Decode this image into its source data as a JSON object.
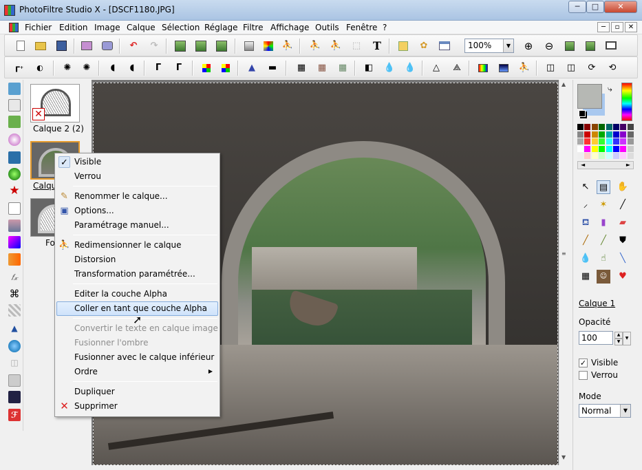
{
  "window": {
    "title": "PhotoFiltre Studio X - [DSCF1180.JPG]",
    "controls": [
      "─",
      "□",
      "✕"
    ]
  },
  "menu": {
    "items": [
      "Fichier",
      "Edition",
      "Image",
      "Calque",
      "Sélection",
      "Réglage",
      "Filtre",
      "Affichage",
      "Outils",
      "Fenêtre",
      "?"
    ],
    "mdi_controls": [
      "─",
      "▫",
      "✕"
    ]
  },
  "toolbar": {
    "zoom_value": "100%",
    "text_tool_glyph": "T"
  },
  "layers": {
    "items": [
      {
        "label": "Calque 2 (2)"
      },
      {
        "label": "Calque 1"
      },
      {
        "label": "Fond"
      }
    ]
  },
  "context_menu": {
    "items": [
      {
        "label": "Visible",
        "checked": true,
        "disabled": false
      },
      {
        "label": "Verrou",
        "disabled": false
      },
      {
        "label": "Renommer le calque...",
        "icon": "rename-icon",
        "disabled": false
      },
      {
        "label": "Options...",
        "icon": "options-icon",
        "disabled": false
      },
      {
        "label": "Paramétrage manuel...",
        "disabled": false
      },
      {
        "label": "Redimensionner le calque",
        "icon": "resize-icon",
        "disabled": false
      },
      {
        "label": "Distorsion",
        "disabled": false
      },
      {
        "label": "Transformation paramétrée...",
        "disabled": false
      },
      {
        "label": "Editer la couche Alpha",
        "disabled": false
      },
      {
        "label": "Coller en tant que couche Alpha",
        "highlighted": true,
        "disabled": false
      },
      {
        "label": "Convertir le texte en calque image",
        "disabled": true
      },
      {
        "label": "Fusionner l'ombre",
        "disabled": true
      },
      {
        "label": "Fusionner avec le calque inférieur",
        "disabled": false
      },
      {
        "label": "Ordre",
        "has_submenu": true,
        "disabled": false
      },
      {
        "label": "Dupliquer",
        "disabled": false
      },
      {
        "label": "Supprimer",
        "icon": "delete-icon",
        "disabled": false
      }
    ]
  },
  "layer_props": {
    "title": "Calque 1",
    "opacity_label": "Opacité",
    "opacity_value": "100",
    "visible_label": "Visible",
    "visible_checked": true,
    "lock_label": "Verrou",
    "lock_checked": false,
    "mode_label": "Mode",
    "mode_value": "Normal"
  },
  "colors": {
    "foreground": "#b6b8b4",
    "background": "#a8c8ef",
    "selection_border": "#e69b2c",
    "menu_hover": "#cfe3fb"
  }
}
